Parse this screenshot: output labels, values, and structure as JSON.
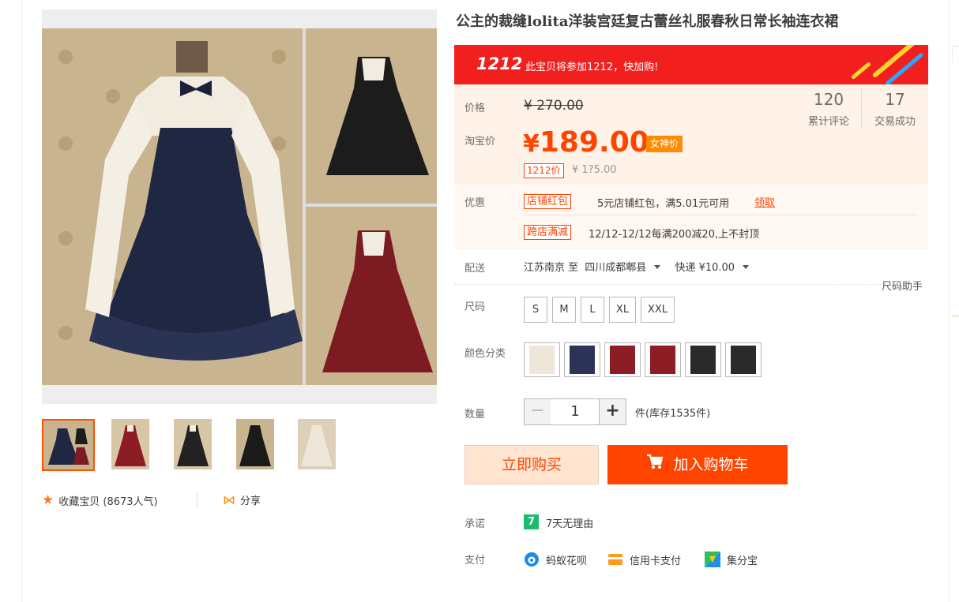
{
  "product": {
    "title": "公主的裁缝lolita洋装宫廷复古蕾丝礼服春秋日常长袖连衣裙"
  },
  "banner": {
    "logo": "1212",
    "message": "此宝贝将参加1212，快加购!"
  },
  "price": {
    "label": "价格",
    "original": "¥ 270.00",
    "taobao_label": "淘宝价",
    "currency": "¥",
    "current": "189.00",
    "current_tag": "女神价",
    "promo_tag": "1212价",
    "promo_price": "¥ 1?5.00"
  },
  "stats": {
    "reviews_count": "120",
    "reviews_label": "累计评论",
    "deals_count": "17",
    "deals_label": "交易成功"
  },
  "promotions": {
    "label": "优惠",
    "coupon_tag": "店铺红包",
    "coupon_text": "5元店铺红包，满5.01元可用",
    "coupon_link": "领取",
    "cross_tag": "跨店满减",
    "cross_text": "12/12-12/12每满200减20,上不封顶"
  },
  "shipping": {
    "label": "配送",
    "from": "江苏南京 至",
    "to": "四川成都郫县",
    "method": "快递 ¥10.00",
    "size_help": "尺码助手"
  },
  "sizes": {
    "label": "尺码",
    "options": [
      "S",
      "M",
      "L",
      "XL",
      "XXL"
    ]
  },
  "colors": {
    "label": "颜色分类",
    "swatches": [
      "#efe6da",
      "#2b3357",
      "#8c1d24",
      "#8c1d24",
      "#2a2a2a",
      "#2a2a2a"
    ]
  },
  "quantity": {
    "label": "数量",
    "minus": "−",
    "value": "1",
    "plus": "+",
    "stock": "件(库存1535件)"
  },
  "actions": {
    "buy_now": "立即购买",
    "add_to_cart": "加入购物车"
  },
  "promise": {
    "label": "承诺",
    "badge": "7",
    "text": "7天无理由"
  },
  "payment": {
    "label": "支付",
    "methods": [
      "蚂蚁花呗",
      "信用卡支付",
      "集分宝"
    ]
  },
  "gallery": {
    "favorite": "收藏宝贝 (8673人气)",
    "share": "分享"
  },
  "colors_theme": {
    "accent": "#ff4400",
    "banner": "#f21f1f",
    "price_bg": "#fff2e8"
  }
}
